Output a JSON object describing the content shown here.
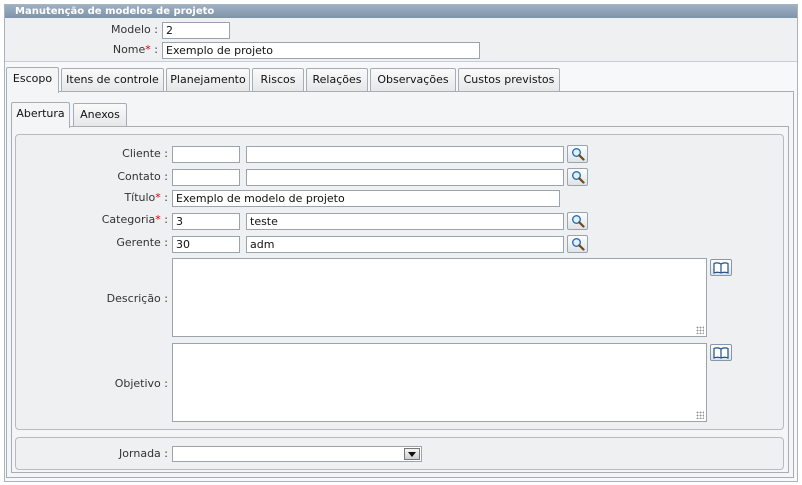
{
  "window": {
    "title": "Manutenção de modelos de projeto"
  },
  "header": {
    "modelo_label": "Modelo :",
    "modelo_value": "2",
    "nome_label": "Nome",
    "nome_suffix": " :",
    "nome_value": "Exemplo de projeto"
  },
  "tabs": [
    "Escopo",
    "Itens de controle",
    "Planejamento",
    "Riscos",
    "Relações",
    "Observações",
    "Custos previstos"
  ],
  "subtabs": [
    "Abertura",
    "Anexos"
  ],
  "form": {
    "cliente": {
      "label": "Cliente :",
      "code": "",
      "name": ""
    },
    "contato": {
      "label": "Contato :",
      "code": "",
      "name": ""
    },
    "titulo": {
      "label": "Título",
      "suffix": " :",
      "value": "Exemplo de modelo de projeto"
    },
    "categoria": {
      "label": "Categoria",
      "suffix": " :",
      "code": "3",
      "name": "teste"
    },
    "gerente": {
      "label": "Gerente :",
      "code": "30",
      "name": "adm"
    },
    "descricao": {
      "label": "Descrição :",
      "value": ""
    },
    "objetivo": {
      "label": "Objetivo :",
      "value": ""
    },
    "jornada": {
      "label": "Jornada :",
      "value": ""
    }
  },
  "required_marker": "*",
  "icons": {
    "lookup": "magnifier-icon",
    "book": "book-icon",
    "dropdown": "chevron-down-icon"
  },
  "colors": {
    "titlebar": "#8a9db1",
    "required": "#dd0000",
    "panel": "#eef0f2"
  }
}
